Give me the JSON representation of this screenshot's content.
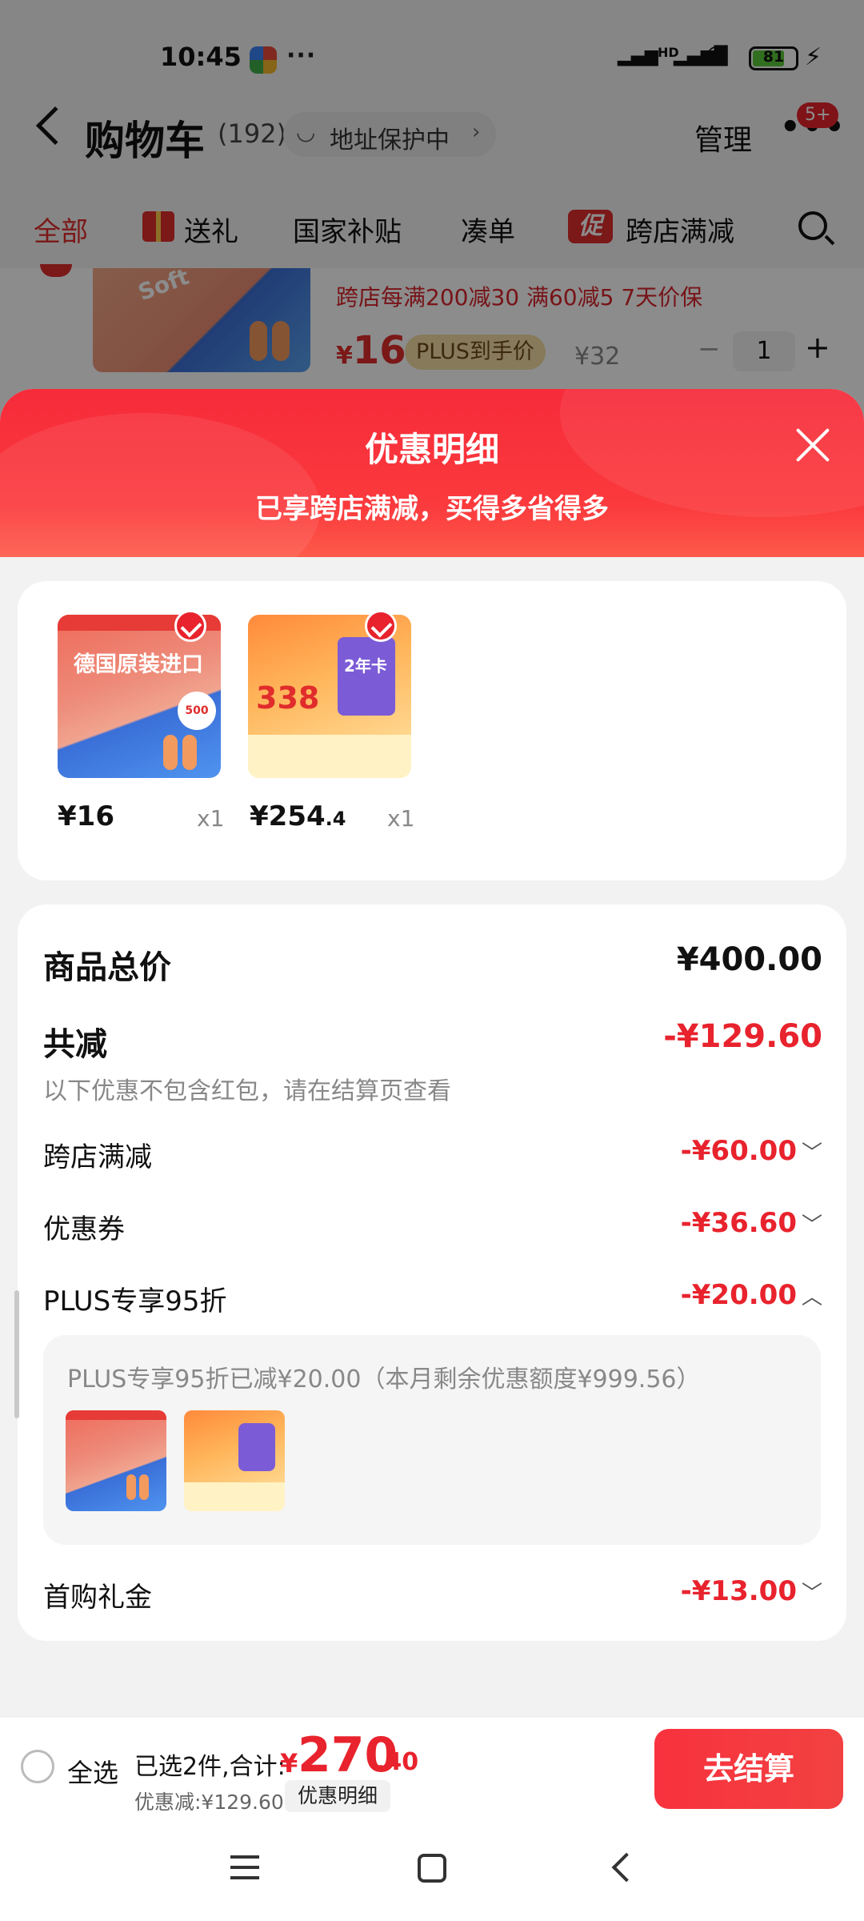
{
  "status_bar": {
    "time": "10:45",
    "network": "HD",
    "battery": "81"
  },
  "nav": {
    "title": "购物车",
    "count": "(192)",
    "address_protection": "地址保护中",
    "manage": "管理",
    "message_badge": "5+"
  },
  "tabs": {
    "all": "全部",
    "gift": "送礼",
    "subsidy": "国家补贴",
    "bundle": "凑单",
    "promo_icon": "促",
    "cross_store": "跨店满减"
  },
  "background_item": {
    "promo_text": "跨店每满200减30  满60减5  7天价保",
    "price_symbol": "¥",
    "price": "16",
    "plus_tag": "PLUS到手价",
    "old_price": "¥32",
    "quantity": "1",
    "image_text": "Soft"
  },
  "sheet": {
    "title": "优惠明细",
    "subtitle": "已享跨店满减，买得多省得多",
    "items": [
      {
        "image_label": "德国原装进口",
        "badge": "500",
        "price_main": "¥16",
        "price_dec": "",
        "qty": "x1"
      },
      {
        "image_label": "338",
        "badge": "2年卡",
        "price_main": "¥254",
        "price_dec": ".4",
        "qty": "x1"
      }
    ],
    "summary": {
      "total_label": "商品总价",
      "total_value": "¥400.00",
      "discount_label": "共减",
      "discount_value": "-¥129.60",
      "note": "以下优惠不包含红包，请在结算页查看",
      "rows": [
        {
          "label": "跨店满减",
          "value": "-¥60.00",
          "chevron": "﹀"
        },
        {
          "label": "优惠券",
          "value": "-¥36.60",
          "chevron": "﹀"
        },
        {
          "label": "PLUS专享95折",
          "value": "-¥20.00",
          "chevron": "︿"
        },
        {
          "label": "首购礼金",
          "value": "-¥13.00",
          "chevron": "﹀"
        }
      ],
      "plus_detail": "PLUS专享95折已减¥20.00（本月剩余优惠额度¥999.56）"
    }
  },
  "bottom_bar": {
    "select_all": "全选",
    "selected_text": "已选2件,合计:",
    "total_symbol": "¥",
    "total_int": "270",
    "total_dec": ".40",
    "discount_text": "优惠减:¥129.60",
    "detail_button": "优惠明细",
    "checkout_button": "去结算"
  },
  "colors": {
    "accent_red": "#e8232d",
    "plus_gold": "#f5dfa5",
    "sheet_header": "#f62b3a"
  },
  "icons": [
    "back-chevron-icon",
    "shield-icon",
    "more-dots-icon",
    "gift-icon",
    "search-icon",
    "close-icon",
    "check-icon",
    "menu-icon",
    "home-icon",
    "back-icon"
  ]
}
